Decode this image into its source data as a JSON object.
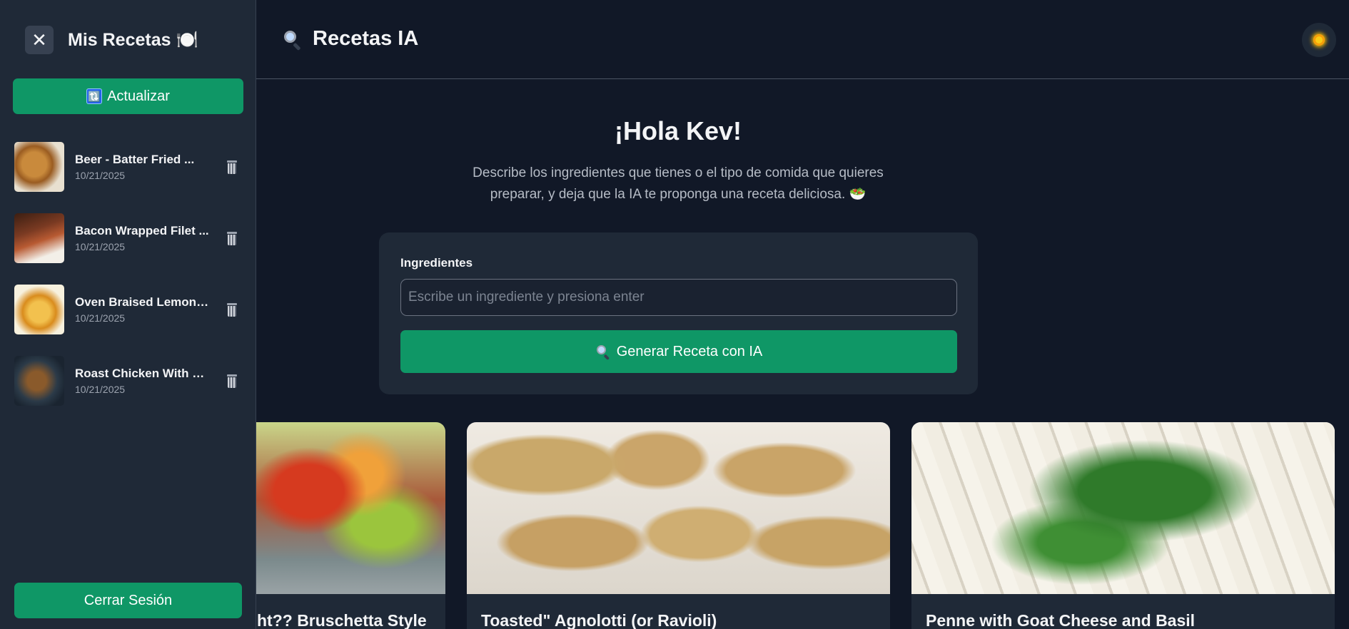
{
  "sidebar": {
    "close_label": "✕",
    "title": "Mis Recetas 🍽️",
    "refresh_icon": "🔃",
    "refresh_label": "Actualizar",
    "items": [
      {
        "title": "Beer - Batter Fried ...",
        "date": "10/21/2025"
      },
      {
        "title": "Bacon Wrapped Filet ...",
        "date": "10/21/2025"
      },
      {
        "title": "Oven Braised Lemon C...",
        "date": "10/21/2025"
      },
      {
        "title": "Roast Chicken With R...",
        "date": "10/21/2025"
      }
    ],
    "logout_label": "Cerrar Sesión"
  },
  "header": {
    "icon": "magnifier-icon",
    "title": "Recetas IA",
    "theme_icon": "sun-icon"
  },
  "hero": {
    "greeting": "¡Hola Kev!",
    "subtitle": "Describe los ingredientes que tienes o el tipo de comida que quieres preparar, y deja que la IA te proponga una receta deliciosa. 🥗"
  },
  "form": {
    "label": "Ingredientes",
    "placeholder": "Escribe un ingrediente y presiona enter",
    "value": "",
    "button_label": "Generar Receta con IA"
  },
  "cards": [
    {
      "title": "ht?? Bruschetta Style"
    },
    {
      "title": "Toasted\" Agnolotti (or Ravioli)"
    },
    {
      "title": "Penne with Goat Cheese and Basil"
    }
  ],
  "colors": {
    "background": "#111827",
    "surface": "#1f2937",
    "accent": "#0f9766"
  }
}
